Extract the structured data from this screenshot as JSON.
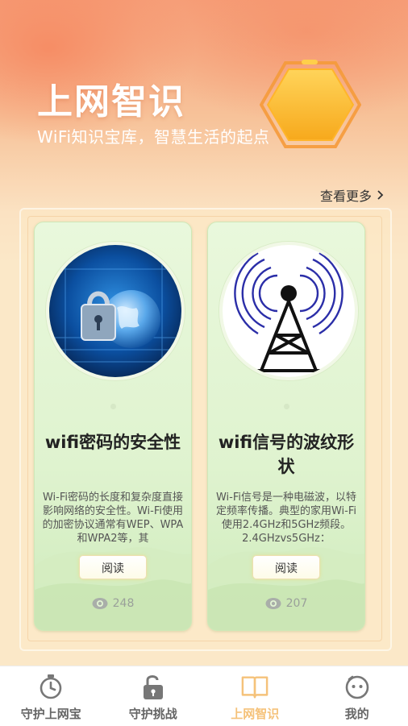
{
  "header": {
    "title": "上网智识",
    "subtitle": "WiFi知识宝库，智慧生活的起点"
  },
  "section": {
    "view_more_label": "查看更多"
  },
  "cards": [
    {
      "title": "wifi密码的安全性",
      "description": "Wi-Fi密码的长度和复杂度直接影响网络的安全性。Wi-Fi使用的加密协议通常有WEP、WPA和WPA2等，其",
      "read_label": "阅读",
      "views": "248",
      "image_icon": "padlock-globe-circuit-image"
    },
    {
      "title": "wifi信号的波纹形状",
      "description": "Wi-Fi信号是一种电磁波，以特定频率传播。典型的家用Wi-Fi使用2.4GHz和5GHz频段。2.4GHzvs5GHz：",
      "read_label": "阅读",
      "views": "207",
      "image_icon": "signal-tower-waves-image"
    }
  ],
  "tabbar": {
    "items": [
      {
        "label": "守护上网宝",
        "icon": "stopwatch-icon",
        "active": false
      },
      {
        "label": "守护挑战",
        "icon": "unlock-icon",
        "active": false
      },
      {
        "label": "上网智识",
        "icon": "book-icon",
        "active": true
      },
      {
        "label": "我的",
        "icon": "face-icon",
        "active": false
      }
    ]
  },
  "colors": {
    "accent": "#f5c27a",
    "hero_orange": "#f6a07a",
    "card_green": "#e2f4d3",
    "emblem": "#fcc02e"
  }
}
